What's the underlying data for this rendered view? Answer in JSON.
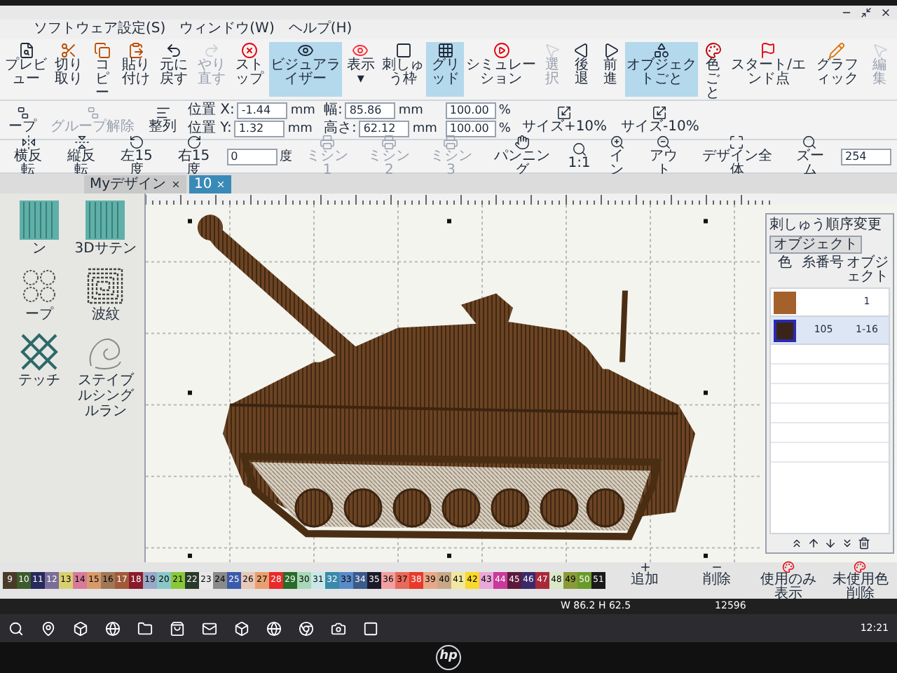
{
  "menu": [
    "ソフトウェア設定(S)",
    "ウィンドウ(W)",
    "ヘルプ(H)"
  ],
  "toolbar_main": [
    {
      "label": "プレビュー",
      "selected": false,
      "disabled": false
    },
    {
      "label": "切り取り",
      "selected": false,
      "disabled": false
    },
    {
      "label": "コピー",
      "selected": false,
      "disabled": false
    },
    {
      "label": "貼り付け",
      "selected": false,
      "disabled": false
    },
    {
      "label": "元に戻す",
      "selected": false,
      "disabled": false
    },
    {
      "label": "やり直す",
      "selected": false,
      "disabled": true
    },
    {
      "label": "ストップ",
      "selected": false,
      "disabled": false
    },
    {
      "label": "ビジュアライザー",
      "selected": true,
      "disabled": false
    },
    {
      "label": "表示 ▾",
      "selected": false,
      "disabled": false
    },
    {
      "label": "刺しゅう枠",
      "selected": false,
      "disabled": false
    },
    {
      "label": "グリッド",
      "selected": true,
      "disabled": false
    },
    {
      "label": "シミュレーション",
      "selected": false,
      "disabled": false
    },
    {
      "label": "選択",
      "selected": false,
      "disabled": true
    },
    {
      "label": "後退",
      "selected": false,
      "disabled": false
    },
    {
      "label": "前進",
      "selected": false,
      "disabled": false
    },
    {
      "label": "オブジェクトごと",
      "selected": true,
      "disabled": false
    },
    {
      "label": "色ごと",
      "selected": false,
      "disabled": false
    },
    {
      "label": "スタート/エンド点",
      "selected": false,
      "disabled": false
    },
    {
      "label": "グラフィック",
      "selected": false,
      "disabled": false
    },
    {
      "label": "編集",
      "selected": false,
      "disabled": true
    }
  ],
  "toolbar_edit": [
    {
      "kind": "button",
      "label": "ープ",
      "disabled": false
    },
    {
      "kind": "button",
      "label": "グループ解除",
      "disabled": true
    },
    {
      "kind": "button",
      "label": "整列",
      "disabled": false
    },
    {
      "kind": "pair",
      "fields": [
        {
          "label": "位置 X:",
          "value": "-1.44",
          "unit": "mm"
        },
        {
          "label": "位置 Y:",
          "value": "1.32",
          "unit": "mm"
        }
      ]
    },
    {
      "kind": "pair",
      "fields": [
        {
          "label": "幅:",
          "value": "85.86",
          "unit": "mm"
        },
        {
          "label": "高さ:",
          "value": "62.12",
          "unit": "mm"
        }
      ]
    },
    {
      "kind": "pair",
      "fields": [
        {
          "value": "100.00",
          "unit": "%"
        },
        {
          "value": "100.00",
          "unit": "%"
        }
      ]
    },
    {
      "kind": "button",
      "label": "サイズ+10%",
      "disabled": false
    },
    {
      "kind": "button",
      "label": "サイズ-10%",
      "disabled": false
    }
  ],
  "toolbar_view": [
    {
      "kind": "button",
      "label": "横反転",
      "disabled": false
    },
    {
      "kind": "button",
      "label": "縦反転",
      "disabled": false
    },
    {
      "kind": "button",
      "label": "左15度",
      "disabled": false
    },
    {
      "kind": "button",
      "label": "右15度",
      "disabled": false
    },
    {
      "kind": "field",
      "value": "0",
      "unit": "度"
    },
    {
      "kind": "button",
      "label": "ミシン1",
      "disabled": true
    },
    {
      "kind": "button",
      "label": "ミシン2",
      "disabled": true
    },
    {
      "kind": "button",
      "label": "ミシン3",
      "disabled": true
    },
    {
      "kind": "button",
      "label": "パンニング",
      "disabled": false
    },
    {
      "kind": "button",
      "label": "1:1",
      "disabled": false
    },
    {
      "kind": "button",
      "label": "イン",
      "disabled": false
    },
    {
      "kind": "button",
      "label": "アウト",
      "disabled": false
    },
    {
      "kind": "button",
      "label": "デザイン全体",
      "disabled": false
    },
    {
      "kind": "button",
      "label": "ズーム",
      "disabled": false
    },
    {
      "kind": "field",
      "value": "254"
    }
  ],
  "tabs": [
    {
      "label": "Myデザイン",
      "selected": false
    },
    {
      "label": "10",
      "selected": true
    }
  ],
  "stitch_types": [
    {
      "label": "ン"
    },
    {
      "label": "3Dサテン"
    },
    {
      "label": "ープ"
    },
    {
      "label": "波紋"
    },
    {
      "label": "テッチ"
    },
    {
      "label": "ステイブルシングルラン"
    }
  ],
  "order_panel": {
    "title": "刺しゅう順序変更",
    "mode_button": "オブジェクト",
    "columns": [
      "色",
      "糸番号",
      "オブジェクト"
    ],
    "rows": [
      {
        "color": "#a5612c",
        "object": "1",
        "selected": false
      },
      {
        "color": "#3a2418",
        "thread": "105",
        "object": "1-16",
        "selected": true
      }
    ]
  },
  "palette": [
    {
      "label": "9",
      "color": "#4a3a2a"
    },
    {
      "label": "10",
      "color": "#3d5b2c"
    },
    {
      "label": "11",
      "color": "#262a5c"
    },
    {
      "label": "12",
      "color": "#7b6c98"
    },
    {
      "label": "13",
      "color": "#d8d070"
    },
    {
      "label": "14",
      "color": "#d87a9a"
    },
    {
      "label": "15",
      "color": "#d89a6a"
    },
    {
      "label": "16",
      "color": "#a07858"
    },
    {
      "label": "17",
      "color": "#a05a3a"
    },
    {
      "label": "18",
      "color": "#8a1a2a"
    },
    {
      "label": "19",
      "color": "#9aa8c8"
    },
    {
      "label": "20",
      "color": "#8ac8c8"
    },
    {
      "label": "21",
      "color": "#8ac83a"
    },
    {
      "label": "22",
      "color": "#2a3a2a"
    },
    {
      "label": "23",
      "color": "#e8e8e8"
    },
    {
      "label": "24",
      "color": "#8a8a8a"
    },
    {
      "label": "25",
      "color": "#3a5aaa"
    },
    {
      "label": "26",
      "color": "#e8c8b8"
    },
    {
      "label": "27",
      "color": "#e8a070"
    },
    {
      "label": "28",
      "color": "#e82a2a"
    },
    {
      "label": "29",
      "color": "#2a6a2a"
    },
    {
      "label": "30",
      "color": "#a8d8b8"
    },
    {
      "label": "31",
      "color": "#c8e8e8"
    },
    {
      "label": "32",
      "color": "#3a8aaa"
    },
    {
      "label": "33",
      "color": "#5a8ac8"
    },
    {
      "label": "34",
      "color": "#3a5a8a"
    },
    {
      "label": "35",
      "color": "#1a1a2a"
    },
    {
      "label": "36",
      "color": "#f0a0a0"
    },
    {
      "label": "37",
      "color": "#e86a5a"
    },
    {
      "label": "38",
      "color": "#e83a2a"
    },
    {
      "label": "39",
      "color": "#e8a888"
    },
    {
      "label": "40",
      "color": "#c8a888"
    },
    {
      "label": "41",
      "color": "#f0e8a0"
    },
    {
      "label": "42",
      "color": "#f8d82a"
    },
    {
      "label": "43",
      "color": "#e8a8d8"
    },
    {
      "label": "44",
      "color": "#c83a9a"
    },
    {
      "label": "45",
      "color": "#5a1a3a"
    },
    {
      "label": "46",
      "color": "#3a2a6a"
    },
    {
      "label": "47",
      "color": "#a82a3a"
    },
    {
      "label": "48",
      "color": "#d8e8c8"
    },
    {
      "label": "49",
      "color": "#8a9a3a"
    },
    {
      "label": "50",
      "color": "#6a9a2a"
    },
    {
      "label": "51",
      "color": "#1a1a1a"
    }
  ],
  "palette_buttons": [
    "追加",
    "削除",
    "使用のみ表示",
    "未使用色削除"
  ],
  "status_bar": {
    "size": "W 86.2 H 62.5",
    "stitches": "12596"
  },
  "taskbar": {
    "clock": "12:21"
  },
  "brand": "hp"
}
